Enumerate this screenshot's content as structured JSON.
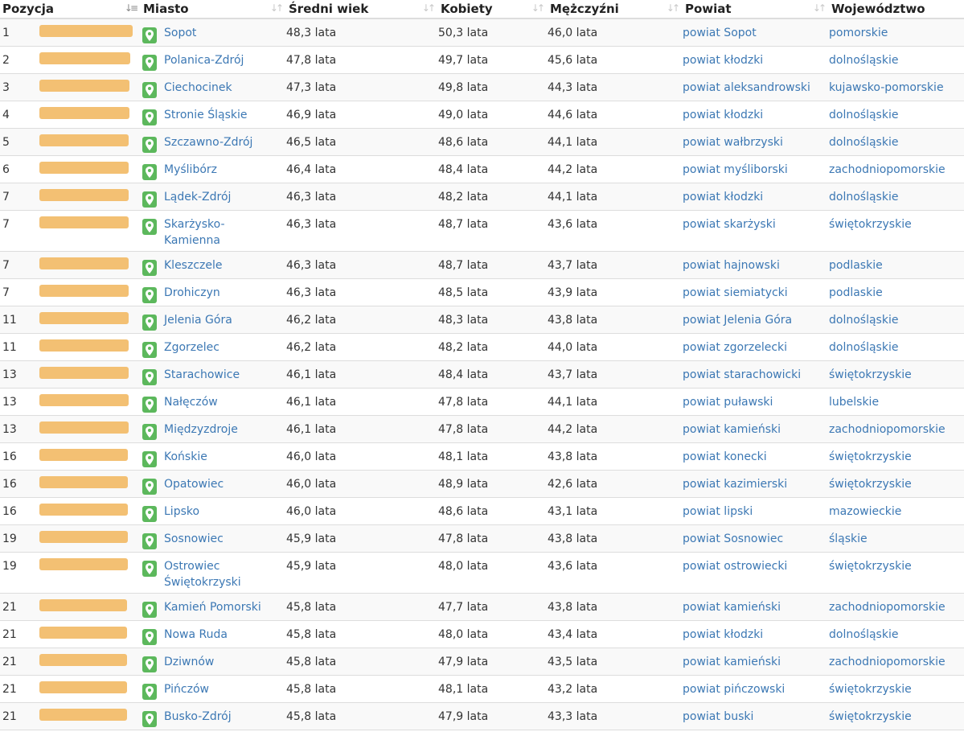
{
  "headers": {
    "pozycja": "Pozycja",
    "miasto": "Miasto",
    "sredni_wiek": "Średni wiek",
    "kobiety": "Kobiety",
    "mezczyzni": "Mężczyźni",
    "powiat": "Powiat",
    "wojewodztwo": "Województwo"
  },
  "colors": {
    "bar": "#f3c073",
    "pin": "#5cb85c",
    "link": "#3c78b4"
  },
  "rows": [
    {
      "pos": "1",
      "bar": 1.0,
      "city": "Sopot",
      "avg": "48,3 lata",
      "women": "50,3 lata",
      "men": "46,0 lata",
      "powiat": "powiat Sopot",
      "woj": "pomorskie"
    },
    {
      "pos": "2",
      "bar": 0.974,
      "city": "Polanica-Zdrój",
      "avg": "47,8 lata",
      "women": "49,7 lata",
      "men": "45,6 lata",
      "powiat": "powiat kłodzki",
      "woj": "dolnośląskie"
    },
    {
      "pos": "3",
      "bar": 0.966,
      "city": "Ciechocinek",
      "avg": "47,3 lata",
      "women": "49,8 lata",
      "men": "44,3 lata",
      "powiat": "powiat aleksandrowski",
      "woj": "kujawsko-pomorskie"
    },
    {
      "pos": "4",
      "bar": 0.966,
      "city": "Stronie Śląskie",
      "avg": "46,9 lata",
      "women": "49,0 lata",
      "men": "44,6 lata",
      "powiat": "powiat kłodzki",
      "woj": "dolnośląskie"
    },
    {
      "pos": "5",
      "bar": 0.957,
      "city": "Szczawno-Zdrój",
      "avg": "46,5 lata",
      "women": "48,6 lata",
      "men": "44,1 lata",
      "powiat": "powiat wałbrzyski",
      "woj": "dolnośląskie"
    },
    {
      "pos": "6",
      "bar": 0.957,
      "city": "Myślibórz",
      "avg": "46,4 lata",
      "women": "48,4 lata",
      "men": "44,2 lata",
      "powiat": "powiat myśliborski",
      "woj": "zachodniopomorskie"
    },
    {
      "pos": "7",
      "bar": 0.957,
      "city": "Lądek-Zdrój",
      "avg": "46,3 lata",
      "women": "48,2 lata",
      "men": "44,1 lata",
      "powiat": "powiat kłodzki",
      "woj": "dolnośląskie"
    },
    {
      "pos": "7",
      "bar": 0.957,
      "city": "Skarżysko-\nKamienna",
      "avg": "46,3 lata",
      "women": "48,7 lata",
      "men": "43,6 lata",
      "powiat": "powiat skarżyski",
      "woj": "świętokrzyskie",
      "tall": true
    },
    {
      "pos": "7",
      "bar": 0.957,
      "city": "Kleszczele",
      "avg": "46,3 lata",
      "women": "48,7 lata",
      "men": "43,7 lata",
      "powiat": "powiat hajnowski",
      "woj": "podlaskie"
    },
    {
      "pos": "7",
      "bar": 0.957,
      "city": "Drohiczyn",
      "avg": "46,3 lata",
      "women": "48,5 lata",
      "men": "43,9 lata",
      "powiat": "powiat siemiatycki",
      "woj": "podlaskie"
    },
    {
      "pos": "11",
      "bar": 0.957,
      "city": "Jelenia Góra",
      "avg": "46,2 lata",
      "women": "48,3 lata",
      "men": "43,8 lata",
      "powiat": "powiat Jelenia Góra",
      "woj": "dolnośląskie"
    },
    {
      "pos": "11",
      "bar": 0.957,
      "city": "Zgorzelec",
      "avg": "46,2 lata",
      "women": "48,2 lata",
      "men": "44,0 lata",
      "powiat": "powiat zgorzelecki",
      "woj": "dolnośląskie"
    },
    {
      "pos": "13",
      "bar": 0.957,
      "city": "Starachowice",
      "avg": "46,1 lata",
      "women": "48,4 lata",
      "men": "43,7 lata",
      "powiat": "powiat starachowicki",
      "woj": "świętokrzyskie"
    },
    {
      "pos": "13",
      "bar": 0.957,
      "city": "Nałęczów",
      "avg": "46,1 lata",
      "women": "47,8 lata",
      "men": "44,1 lata",
      "powiat": "powiat puławski",
      "woj": "lubelskie"
    },
    {
      "pos": "13",
      "bar": 0.957,
      "city": "Międzyzdroje",
      "avg": "46,1 lata",
      "women": "47,8 lata",
      "men": "44,2 lata",
      "powiat": "powiat kamieński",
      "woj": "zachodniopomorskie"
    },
    {
      "pos": "16",
      "bar": 0.949,
      "city": "Końskie",
      "avg": "46,0 lata",
      "women": "48,1 lata",
      "men": "43,8 lata",
      "powiat": "powiat konecki",
      "woj": "świętokrzyskie"
    },
    {
      "pos": "16",
      "bar": 0.949,
      "city": "Opatowiec",
      "avg": "46,0 lata",
      "women": "48,9 lata",
      "men": "42,6 lata",
      "powiat": "powiat kazimierski",
      "woj": "świętokrzyskie"
    },
    {
      "pos": "16",
      "bar": 0.949,
      "city": "Lipsko",
      "avg": "46,0 lata",
      "women": "48,6 lata",
      "men": "43,1 lata",
      "powiat": "powiat lipski",
      "woj": "mazowieckie"
    },
    {
      "pos": "19",
      "bar": 0.949,
      "city": "Sosnowiec",
      "avg": "45,9 lata",
      "women": "47,8 lata",
      "men": "43,8 lata",
      "powiat": "powiat Sosnowiec",
      "woj": "śląskie"
    },
    {
      "pos": "19",
      "bar": 0.949,
      "city": "Ostrowiec\nŚwiętokrzyski",
      "avg": "45,9 lata",
      "women": "48,0 lata",
      "men": "43,6 lata",
      "powiat": "powiat ostrowiecki",
      "woj": "świętokrzyskie",
      "tall": true
    },
    {
      "pos": "21",
      "bar": 0.94,
      "city": "Kamień Pomorski",
      "avg": "45,8 lata",
      "women": "47,7 lata",
      "men": "43,8 lata",
      "powiat": "powiat kamieński",
      "woj": "zachodniopomorskie"
    },
    {
      "pos": "21",
      "bar": 0.94,
      "city": "Nowa Ruda",
      "avg": "45,8 lata",
      "women": "48,0 lata",
      "men": "43,4 lata",
      "powiat": "powiat kłodzki",
      "woj": "dolnośląskie"
    },
    {
      "pos": "21",
      "bar": 0.94,
      "city": "Dziwnów",
      "avg": "45,8 lata",
      "women": "47,9 lata",
      "men": "43,5 lata",
      "powiat": "powiat kamieński",
      "woj": "zachodniopomorskie"
    },
    {
      "pos": "21",
      "bar": 0.94,
      "city": "Pińczów",
      "avg": "45,8 lata",
      "women": "48,1 lata",
      "men": "43,2 lata",
      "powiat": "powiat pińczowski",
      "woj": "świętokrzyskie"
    },
    {
      "pos": "21",
      "bar": 0.94,
      "city": "Busko-Zdrój",
      "avg": "45,8 lata",
      "women": "47,9 lata",
      "men": "43,3 lata",
      "powiat": "powiat buski",
      "woj": "świętokrzyskie"
    }
  ]
}
